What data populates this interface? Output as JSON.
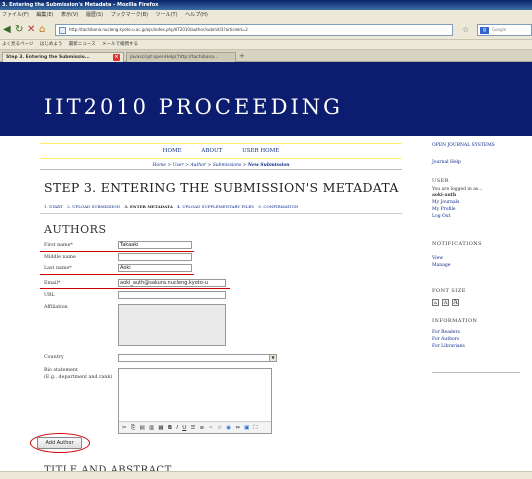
{
  "browser": {
    "window_title": "3. Entering the Submission's Metadata - Mozilla Firefox",
    "menu": [
      "ファイル(F)",
      "編集(E)",
      "表示(V)",
      "履歴(S)",
      "ブックマーク(B)",
      "ツール(T)",
      "ヘルプ(H)"
    ],
    "url": "http://tachibana.nucleng.kyoto-u.ac.jp/ojs/index.php/IIT2010/author/submit/3?articleId=2",
    "search_placeholder": "Google",
    "bookmarks": [
      "よく見るページ",
      "はじめよう",
      "最新ニュース",
      "メールで検問する"
    ],
    "tabs": [
      {
        "label": "Step 3. Entering the Submissio...",
        "active": true
      },
      {
        "label": "javascript:openHelp('http://tachibana...",
        "active": false
      }
    ]
  },
  "site": {
    "title": "IIT2010 PROCEEDING"
  },
  "topnav": [
    "HOME",
    "ABOUT",
    "USER HOME"
  ],
  "breadcrumb": {
    "items": [
      "Home",
      "User",
      "Author",
      "Submissions"
    ],
    "current": "New Submission",
    "separator": ">"
  },
  "page_title": "STEP 3. ENTERING THE SUBMISSION'S METADATA",
  "steps": [
    {
      "label": "1. START",
      "current": false
    },
    {
      "label": "2. UPLOAD SUBMISSION",
      "current": false
    },
    {
      "label": "3. ENTER METADATA",
      "current": true
    },
    {
      "label": "4. UPLOAD SUPPLEMENTARY FILES",
      "current": false
    },
    {
      "label": "5. CONFIRMATION",
      "current": false
    }
  ],
  "authors": {
    "heading": "AUTHORS",
    "fields": {
      "first_name": {
        "label": "First name*",
        "value": "Takaaki"
      },
      "middle_name": {
        "label": "Middle name",
        "value": ""
      },
      "last_name": {
        "label": "Last name*",
        "value": "Aoki"
      },
      "email": {
        "label": "Email*",
        "value": "aoki_auth@sakura.nucleng.kyoto-u"
      },
      "url": {
        "label": "URL",
        "value": ""
      },
      "affiliation": {
        "label": "Affiliation",
        "value": ""
      },
      "country": {
        "label": "Country",
        "value": ""
      },
      "bio_label": "Bio statement",
      "bio_hint": "(E.g., department and rank)"
    },
    "add_author": "Add Author"
  },
  "next_section": "TITLE AND ABSTRACT",
  "sidebar": {
    "ojs": "OPEN JOURNAL SYSTEMS",
    "journal_help": "Journal Help",
    "user_head": "USER",
    "logged_in": "You are logged in as...",
    "username": "aoki-auth",
    "my_journals": "My Journals",
    "my_profile": "My Profile",
    "logout": "Log Out",
    "notifications_head": "NOTIFICATIONS",
    "view": "View",
    "manage": "Manage",
    "font_size_head": "FONT SIZE",
    "font_sizes": [
      "A",
      "A",
      "A"
    ],
    "information_head": "INFORMATION",
    "for_readers": "For Readers",
    "for_authors": "For Authors",
    "for_librarians": "For Librarians"
  },
  "colors": {
    "header_bg": "#0c1c6e",
    "link": "#0b2a8a",
    "annotation": "#d10000",
    "nav_border": "#ffee66"
  }
}
